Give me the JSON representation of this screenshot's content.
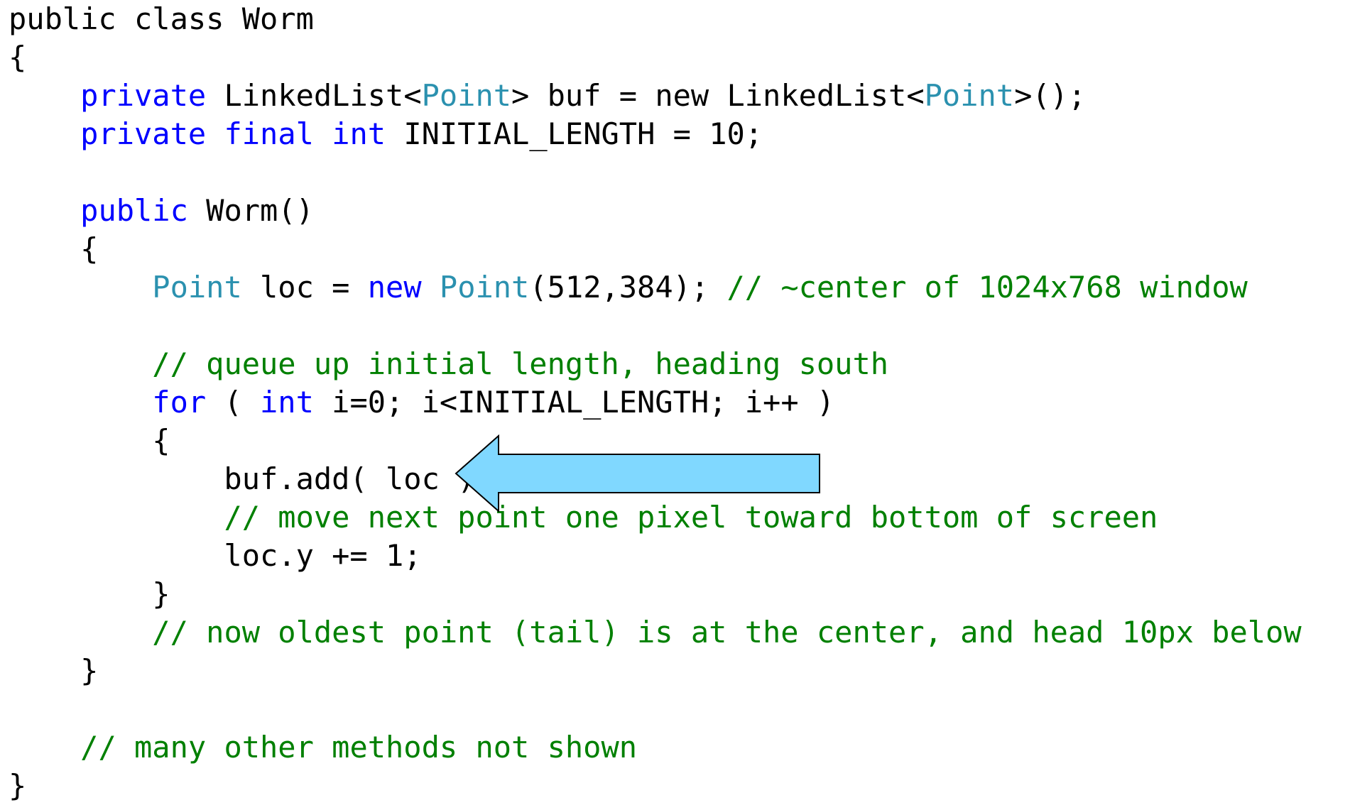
{
  "colors": {
    "keyword": "#0000ff",
    "type": "#2b91af",
    "comment": "#008000",
    "text": "#000000",
    "arrow_fill": "#80d8ff",
    "arrow_stroke": "#000000"
  },
  "code": {
    "lines": [
      [
        {
          "c": "plain",
          "t": "public class Worm"
        }
      ],
      [
        {
          "c": "plain",
          "t": "{"
        }
      ],
      [
        {
          "c": "plain",
          "t": "    "
        },
        {
          "c": "kw",
          "t": "private"
        },
        {
          "c": "plain",
          "t": " LinkedList<"
        },
        {
          "c": "ty",
          "t": "Point"
        },
        {
          "c": "plain",
          "t": "> buf = new LinkedList<"
        },
        {
          "c": "ty",
          "t": "Point"
        },
        {
          "c": "plain",
          "t": ">();"
        }
      ],
      [
        {
          "c": "plain",
          "t": "    "
        },
        {
          "c": "kw",
          "t": "private"
        },
        {
          "c": "plain",
          "t": " "
        },
        {
          "c": "kw",
          "t": "final"
        },
        {
          "c": "plain",
          "t": " "
        },
        {
          "c": "kw",
          "t": "int"
        },
        {
          "c": "plain",
          "t": " INITIAL_LENGTH = 10;"
        }
      ],
      [
        {
          "c": "plain",
          "t": ""
        }
      ],
      [
        {
          "c": "plain",
          "t": "    "
        },
        {
          "c": "kw",
          "t": "public"
        },
        {
          "c": "plain",
          "t": " Worm()"
        }
      ],
      [
        {
          "c": "plain",
          "t": "    {"
        }
      ],
      [
        {
          "c": "plain",
          "t": "        "
        },
        {
          "c": "ty",
          "t": "Point"
        },
        {
          "c": "plain",
          "t": " loc = "
        },
        {
          "c": "kw",
          "t": "new"
        },
        {
          "c": "plain",
          "t": " "
        },
        {
          "c": "ty",
          "t": "Point"
        },
        {
          "c": "plain",
          "t": "(512,384); "
        },
        {
          "c": "cm",
          "t": "// ~center of 1024x768 window"
        }
      ],
      [
        {
          "c": "plain",
          "t": ""
        }
      ],
      [
        {
          "c": "plain",
          "t": "        "
        },
        {
          "c": "cm",
          "t": "// queue up initial length, heading south"
        }
      ],
      [
        {
          "c": "plain",
          "t": "        "
        },
        {
          "c": "kw",
          "t": "for"
        },
        {
          "c": "plain",
          "t": " ( "
        },
        {
          "c": "kw",
          "t": "int"
        },
        {
          "c": "plain",
          "t": " i=0; i<INITIAL_LENGTH; i++ )"
        }
      ],
      [
        {
          "c": "plain",
          "t": "        {"
        }
      ],
      [
        {
          "c": "plain",
          "t": "            buf.add( loc );"
        }
      ],
      [
        {
          "c": "plain",
          "t": "            "
        },
        {
          "c": "cm",
          "t": "// move next point one pixel toward bottom of screen"
        }
      ],
      [
        {
          "c": "plain",
          "t": "            loc.y += 1;"
        }
      ],
      [
        {
          "c": "plain",
          "t": "        }"
        }
      ],
      [
        {
          "c": "plain",
          "t": "        "
        },
        {
          "c": "cm",
          "t": "// now oldest point (tail) is at the center, and head 10px below"
        }
      ],
      [
        {
          "c": "plain",
          "t": "    }"
        }
      ],
      [
        {
          "c": "plain",
          "t": ""
        }
      ],
      [
        {
          "c": "plain",
          "t": "    "
        },
        {
          "c": "cm",
          "t": "// many other methods not shown"
        }
      ],
      [
        {
          "c": "plain",
          "t": "}"
        }
      ]
    ]
  }
}
